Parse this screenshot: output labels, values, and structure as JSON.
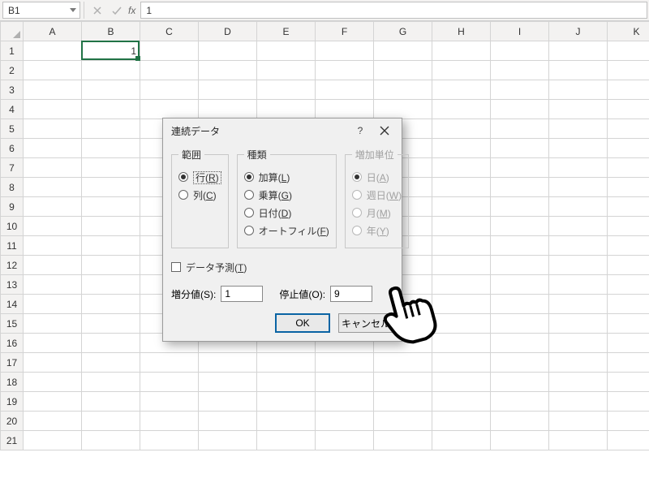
{
  "namebox": {
    "ref": "B1"
  },
  "formula_bar": {
    "fx_label": "fx",
    "value": "1"
  },
  "grid": {
    "columns": [
      "A",
      "B",
      "C",
      "D",
      "E",
      "F",
      "G",
      "H",
      "I",
      "J",
      "K"
    ],
    "rows": 21,
    "active": {
      "col": "B",
      "row": 1,
      "value": "1"
    }
  },
  "dialog": {
    "title": "連続データ",
    "group_range": {
      "legend": "範囲",
      "options": [
        {
          "label_pre": "行(",
          "key": "R",
          "label_post": ")",
          "checked": true,
          "focus": true
        },
        {
          "label_pre": "列(",
          "key": "C",
          "label_post": ")",
          "checked": false
        }
      ]
    },
    "group_type": {
      "legend": "種類",
      "options": [
        {
          "label_pre": "加算(",
          "key": "L",
          "label_post": ")",
          "checked": true
        },
        {
          "label_pre": "乗算(",
          "key": "G",
          "label_post": ")",
          "checked": false
        },
        {
          "label_pre": "日付(",
          "key": "D",
          "label_post": ")",
          "checked": false
        },
        {
          "label_pre": "オートフィル(",
          "key": "F",
          "label_post": ")",
          "checked": false
        }
      ]
    },
    "group_dateunit": {
      "legend": "増加単位",
      "options": [
        {
          "label_pre": "日(",
          "key": "A",
          "label_post": ")",
          "checked": true
        },
        {
          "label_pre": "週日(",
          "key": "W",
          "label_post": ")",
          "checked": false
        },
        {
          "label_pre": "月(",
          "key": "M",
          "label_post": ")",
          "checked": false
        },
        {
          "label_pre": "年(",
          "key": "Y",
          "label_post": ")",
          "checked": false
        }
      ]
    },
    "trend_checkbox": {
      "label_pre": "データ予測(",
      "key": "T",
      "label_post": ")",
      "checked": false
    },
    "step": {
      "label_pre": "増分値(",
      "key": "S",
      "label_post": "):",
      "value": "1"
    },
    "stop": {
      "label_pre": "停止値(",
      "key": "O",
      "label_post": "):",
      "value": "9"
    },
    "buttons": {
      "ok": "OK",
      "cancel": "キャンセル"
    }
  }
}
